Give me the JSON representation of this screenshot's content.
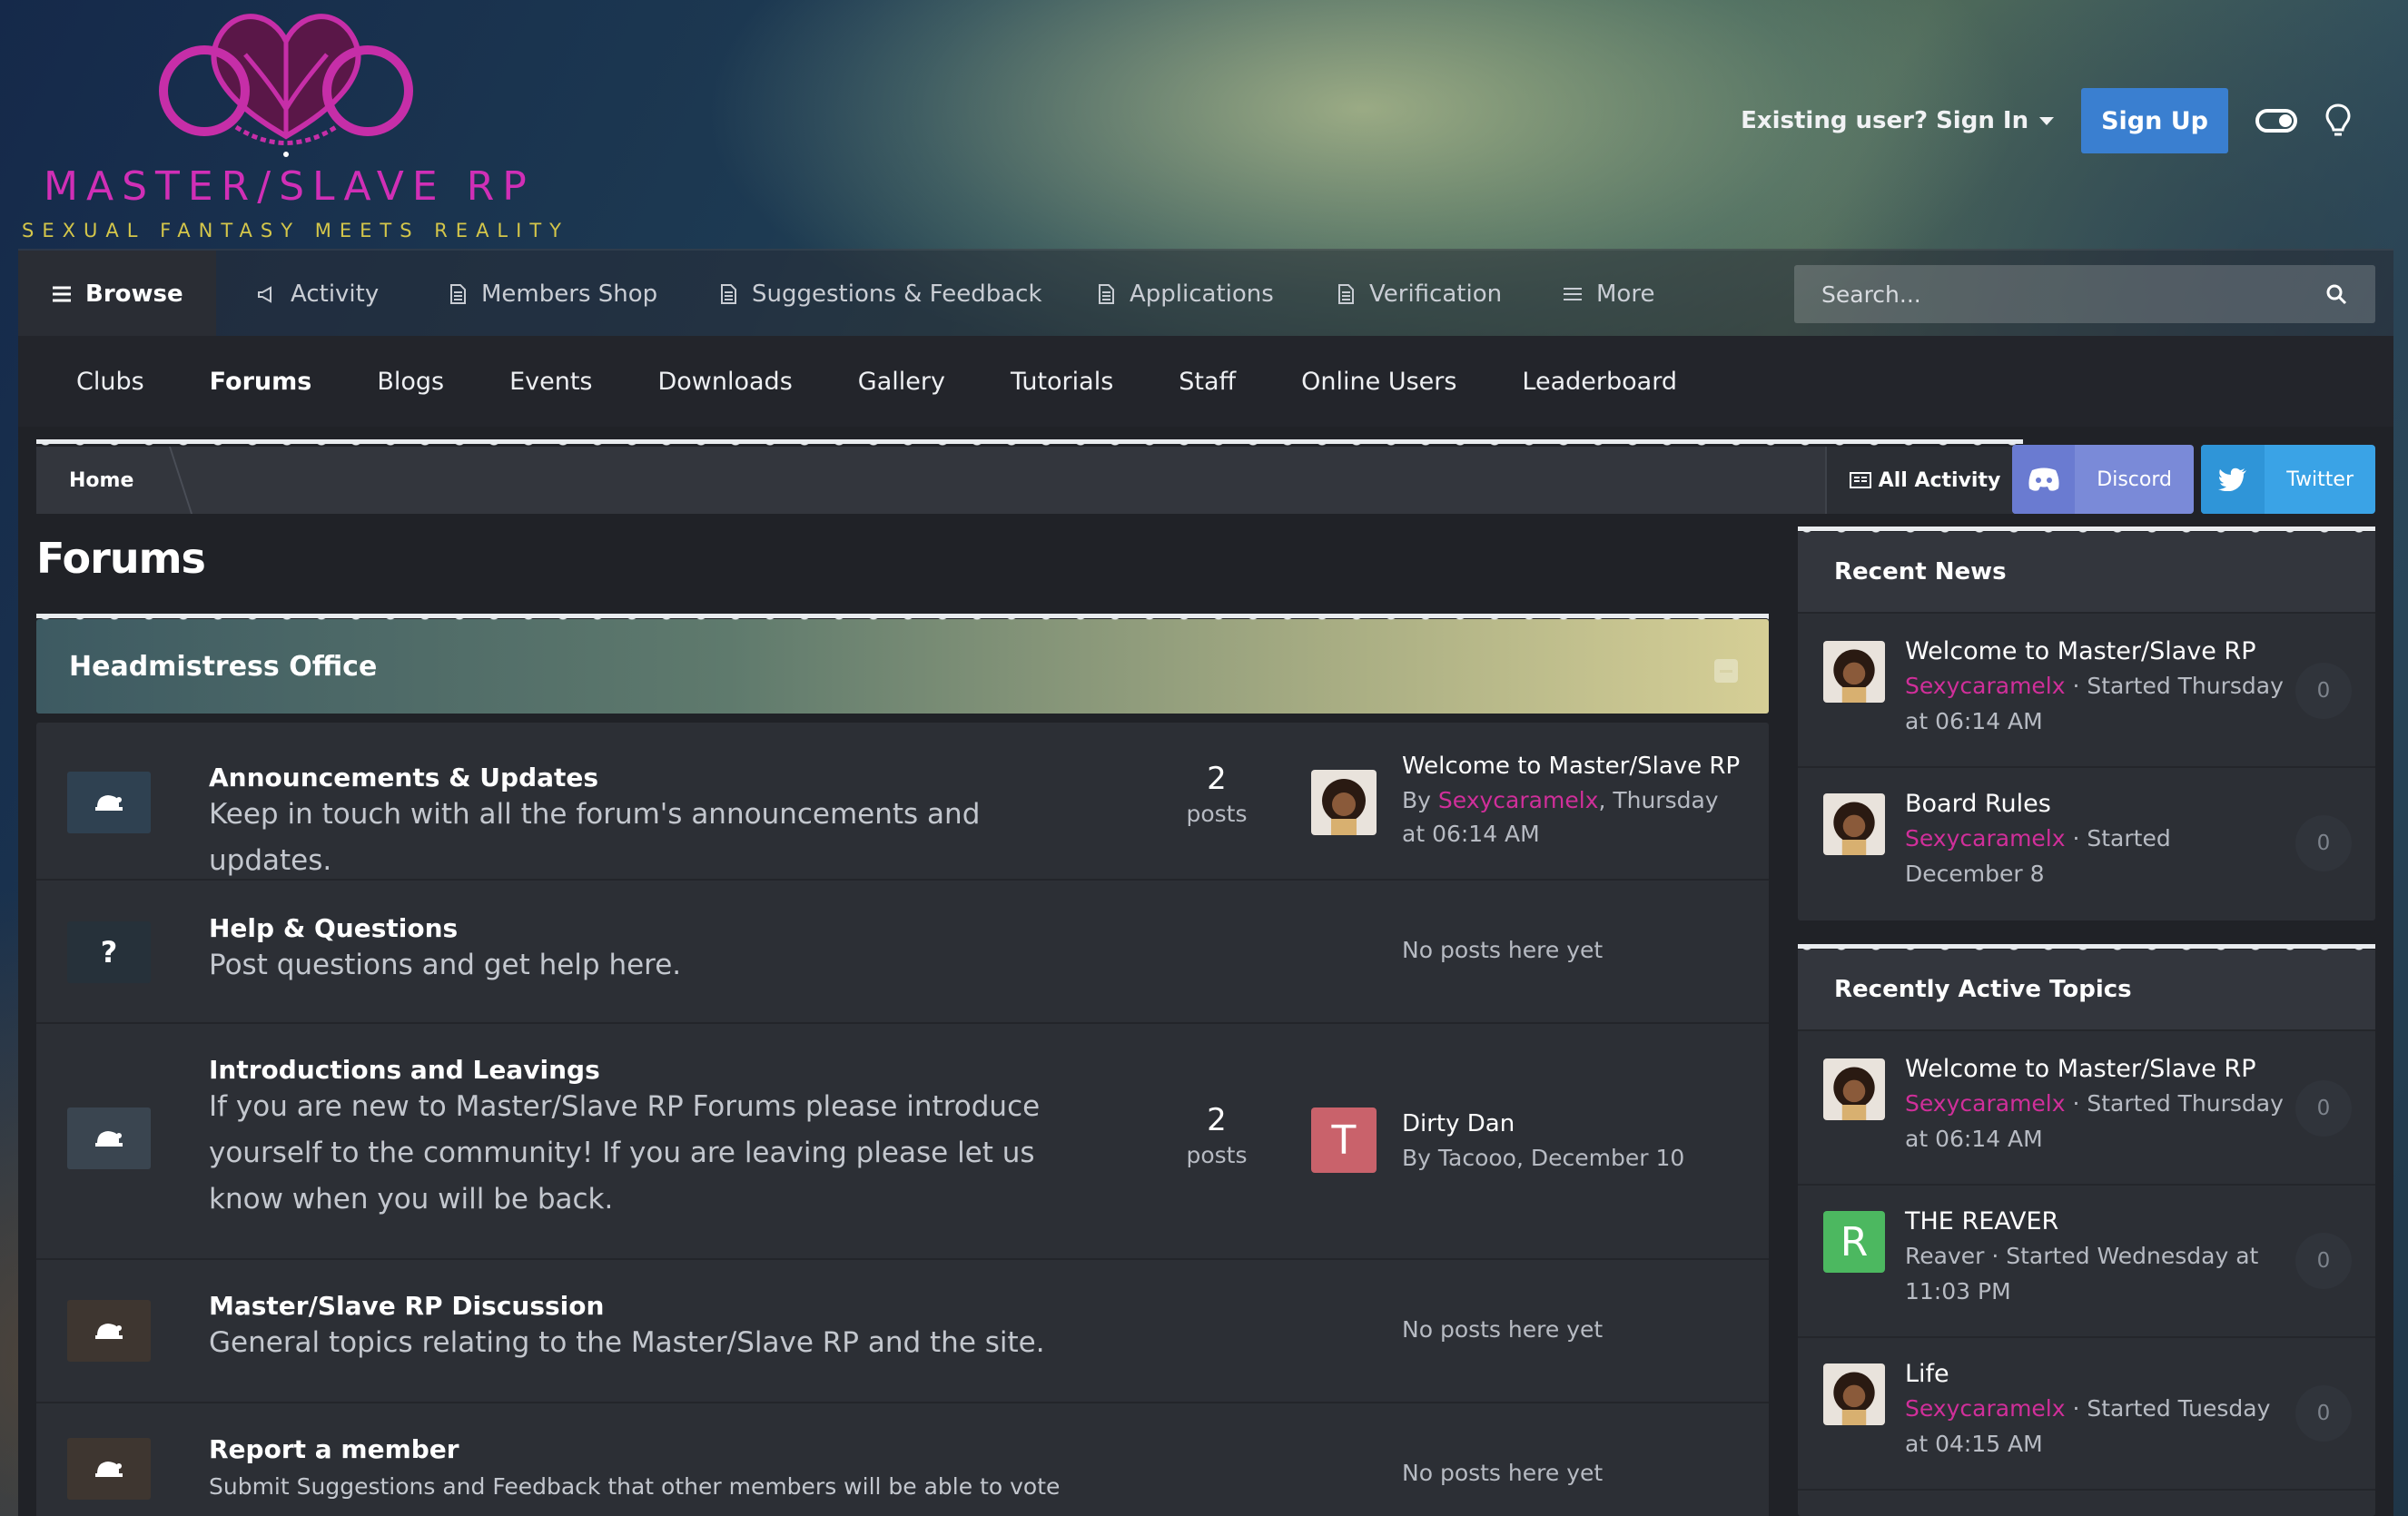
{
  "brand": {
    "name": "MASTER/SLAVE RP",
    "tagline": "SEXUAL FANTASY MEETS REALITY",
    "colors": {
      "pink": "#d02fb6",
      "gold": "#d4c64a",
      "accent_blue": "#3a7fd0"
    }
  },
  "user_bar": {
    "signin_label": "Existing user? Sign In",
    "signup_label": "Sign Up",
    "icons": [
      "chevron-down-icon",
      "theme-toggle-icon",
      "lightbulb-icon"
    ]
  },
  "nav": {
    "primary": [
      {
        "label": "Browse",
        "icon": "menu-icon",
        "active": true
      },
      {
        "label": "Activity",
        "icon": "megaphone-icon"
      },
      {
        "label": "Members Shop",
        "icon": "document-icon"
      },
      {
        "label": "Suggestions & Feedback",
        "icon": "document-icon"
      },
      {
        "label": "Applications",
        "icon": "document-icon"
      },
      {
        "label": "Verification",
        "icon": "document-icon"
      },
      {
        "label": "More",
        "icon": "menu-icon"
      }
    ],
    "search_placeholder": "Search...",
    "secondary": [
      "Clubs",
      "Forums",
      "Blogs",
      "Events",
      "Downloads",
      "Gallery",
      "Tutorials",
      "Staff",
      "Online Users",
      "Leaderboard"
    ],
    "secondary_current": "Forums"
  },
  "breadcrumb": {
    "home": "Home",
    "all_activity": "All Activity"
  },
  "social": {
    "discord": "Discord",
    "twitter": "Twitter"
  },
  "page": {
    "title": "Forums"
  },
  "category": {
    "title": "Headmistress Office",
    "forums": [
      {
        "name": "Announcements & Updates",
        "description": "Keep in touch with all the forum's announcements and updates.",
        "icon": "forum-bubble-icon",
        "post_count": "2",
        "post_count_label": "posts",
        "last_post": {
          "title": "Welcome to Master/Slave RP",
          "by": "By",
          "author": "Sexycaramelx",
          "when": ", Thursday at 06:14 AM"
        }
      },
      {
        "name": "Help & Questions",
        "description": "Post questions and get help here.",
        "icon": "question-icon",
        "icon_text": "?",
        "no_posts": "No posts here yet"
      },
      {
        "name": "Introductions and Leavings",
        "description": "If you are new to Master/Slave RP Forums please introduce yourself to the community! If you are leaving please let us know when you will be back.",
        "icon": "forum-bubble-icon",
        "post_count": "2",
        "post_count_label": "posts",
        "last_post": {
          "title": "Dirty Dan",
          "by": "By Tacooo, December 10",
          "avatar_letter": "T",
          "avatar_color": "#c9626b"
        }
      },
      {
        "name": "Master/Slave RP Discussion",
        "description": "General topics relating to the Master/Slave RP and the site.",
        "icon": "forum-bubble-icon",
        "no_posts": "No posts here yet"
      },
      {
        "name": "Report a member",
        "description": "Submit Suggestions and Feedback that other members will be able to vote on.",
        "icon": "forum-bubble-icon",
        "no_posts": "No posts here yet"
      }
    ]
  },
  "sidebar": {
    "recent_news": {
      "title": "Recent News",
      "items": [
        {
          "title": "Welcome to Master/Slave RP",
          "author": "Sexycaramelx",
          "meta": " · Started Thursday at 06:14 AM",
          "count": "0"
        },
        {
          "title": "Board Rules",
          "author": "Sexycaramelx",
          "meta": " · Started December 8",
          "count": "0"
        }
      ]
    },
    "recent_topics": {
      "title": "Recently Active Topics",
      "items": [
        {
          "title": "Welcome to Master/Slave RP",
          "author": "Sexycaramelx",
          "meta": " · Started Thursday at 06:14 AM",
          "count": "0"
        },
        {
          "title": "THE REAVER",
          "meta_plain": "Reaver · Started Wednesday at 11:03 PM",
          "count": "0",
          "avatar_letter": "R",
          "avatar_color": "#4cb860"
        },
        {
          "title": "Life",
          "author": "Sexycaramelx",
          "meta": " · Started Tuesday at 04:15 AM",
          "count": "0"
        }
      ]
    }
  }
}
